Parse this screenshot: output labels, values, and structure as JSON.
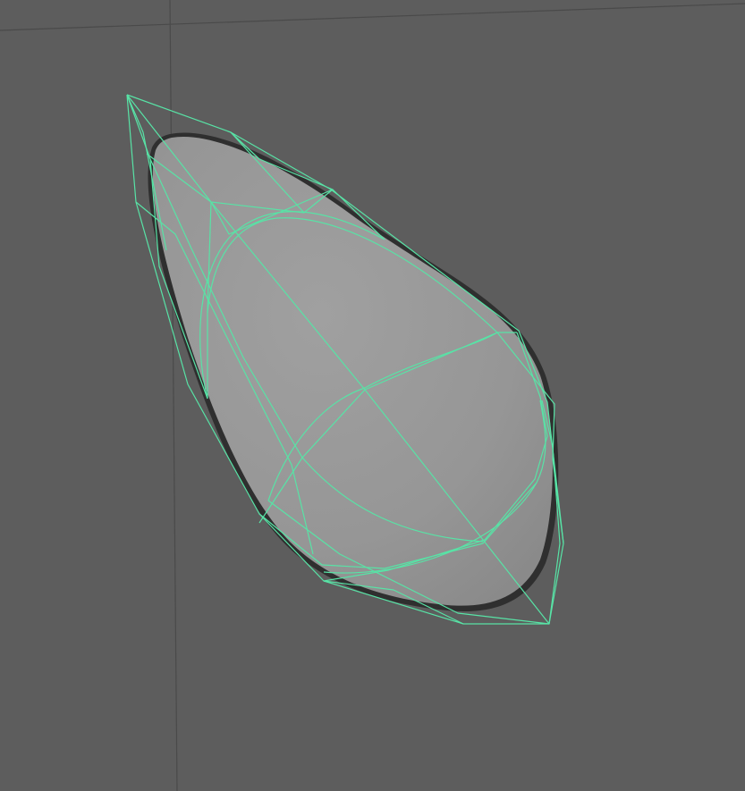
{
  "viewport": {
    "background_color": "#5d5d5d",
    "grid_color": "#4a4a4a",
    "surface_fill": "#999999",
    "surface_shadow": "#2f2f2f",
    "wireframe_color": "#58e3a6",
    "selected": true
  }
}
